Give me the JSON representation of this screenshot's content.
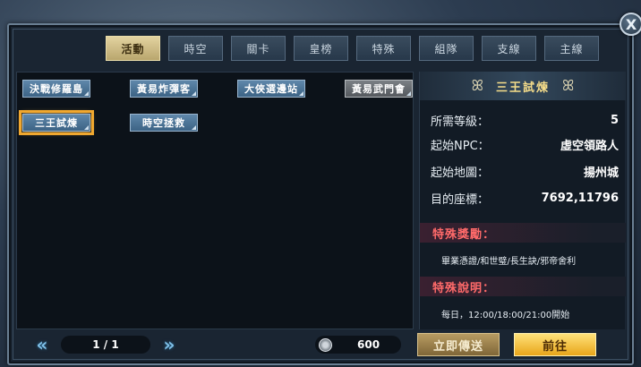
{
  "close_label": "X",
  "tabs": [
    {
      "label": "活動",
      "active": true
    },
    {
      "label": "時空",
      "active": false
    },
    {
      "label": "關卡",
      "active": false
    },
    {
      "label": "皇榜",
      "active": false
    },
    {
      "label": "特殊",
      "active": false
    },
    {
      "label": "組隊",
      "active": false
    },
    {
      "label": "支線",
      "active": false
    },
    {
      "label": "主線",
      "active": false
    }
  ],
  "quests": [
    {
      "label": "決戰修羅島",
      "state": "normal"
    },
    {
      "label": "黃易炸彈客",
      "state": "normal"
    },
    {
      "label": "大俠選邊站",
      "state": "normal"
    },
    {
      "label": "黃易武門會",
      "state": "grey"
    },
    {
      "label": "三王試煉",
      "state": "selected"
    },
    {
      "label": "時空拯救",
      "state": "normal"
    }
  ],
  "info": {
    "title": "三王試煉",
    "rows": [
      {
        "label": "所需等級：",
        "value": "5"
      },
      {
        "label": "起始NPC：",
        "value": "虛空領路人"
      },
      {
        "label": "起始地圖：",
        "value": "揚州城"
      },
      {
        "label": "目的座標：",
        "value": "7692,11796"
      }
    ],
    "reward_heading": "特殊獎勵：",
    "reward_text": "畢業憑證/和世璧/長生訣/邪帝舍利",
    "desc_heading": "特殊說明：",
    "desc_text": "每日，12:00/18:00/21:00開始"
  },
  "pager": {
    "prev_icon": "double-chevron-left",
    "next_icon": "double-chevron-right",
    "page_text": "1 / 1"
  },
  "currency": {
    "icon": "coin-icon",
    "value": "600"
  },
  "buttons": {
    "teleport": "立即傳送",
    "goto": "前往"
  }
}
